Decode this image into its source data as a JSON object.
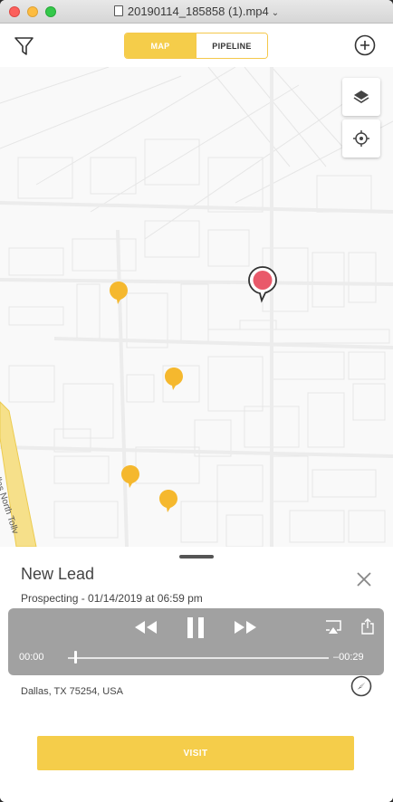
{
  "window": {
    "title": "20190114_185858 (1).mp4"
  },
  "header": {
    "tabs": [
      {
        "label": "MAP",
        "active": true
      },
      {
        "label": "PIPELINE",
        "active": false
      }
    ]
  },
  "map": {
    "road_label": "Dallas North Tollv",
    "pins": [
      {
        "color": "#f5b82e",
        "selected": false
      },
      {
        "color": "#f5b82e",
        "selected": false
      },
      {
        "color": "#f5b82e",
        "selected": false
      },
      {
        "color": "#f5b82e",
        "selected": false
      },
      {
        "color": "#e9596a",
        "selected": true
      }
    ]
  },
  "lead": {
    "title": "New Lead",
    "status": "Prospecting - 01/14/2019 at 06:59 pm",
    "address": "Dallas,  TX 75254,  USA"
  },
  "actions": {
    "visit_label": "VISIT"
  },
  "player": {
    "elapsed": "00:00",
    "remaining": "–00:29",
    "progress": 0.01
  },
  "colors": {
    "accent": "#f5cd4a",
    "pin": "#f5b82e",
    "selected_pin": "#e9596a"
  }
}
